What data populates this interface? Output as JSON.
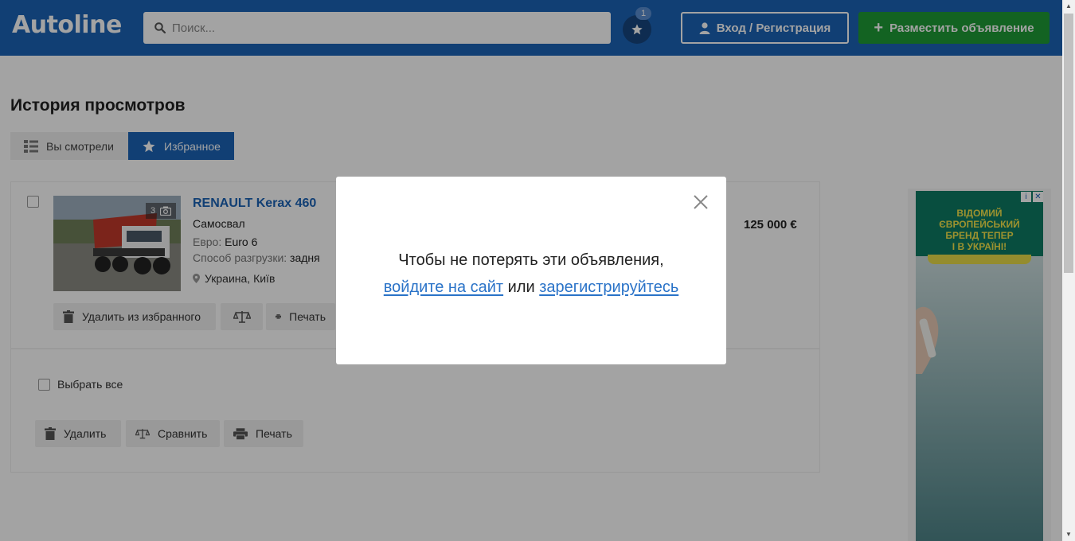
{
  "header": {
    "logo": "Autoline",
    "search_placeholder": "Поиск...",
    "favorites_count": "1",
    "login_label": "Вход / Регистрация",
    "post_label": "Разместить объявление"
  },
  "page": {
    "title": "История просмотров",
    "tabs": [
      {
        "label": "Вы смотрели",
        "active": false
      },
      {
        "label": "Избранное",
        "active": true
      }
    ]
  },
  "listing": {
    "photo_count": "3",
    "title": "RENAULT Kerax 460",
    "type": "Самосвал",
    "euro_label": "Евро:",
    "euro_value": "Euro 6",
    "unload_label": "Способ разгрузки:",
    "unload_value": "задня",
    "location": "Украина, Київ",
    "price": "125 000 €",
    "actions": {
      "remove_fav": "Удалить из избранного",
      "print": "Печать"
    }
  },
  "bulk": {
    "select_all": "Выбрать все",
    "delete": "Удалить",
    "compare": "Сравнить",
    "print": "Печать"
  },
  "ad": {
    "line1": "ВІДОМИЙ",
    "line2": "ЄВРОПЕЙСЬКИЙ",
    "line3": "БРЕНД ТЕПЕР",
    "line4": "І В УКРАЇНІ!"
  },
  "modal": {
    "line1": "Чтобы не потерять эти объявления,",
    "login_link": "войдите на сайт",
    "or": "или",
    "register_link": "зарегистрируйтесь"
  },
  "colors": {
    "header_bg": "#1b63b6",
    "accent_green": "#1f9b36",
    "link": "#2a73c8"
  }
}
